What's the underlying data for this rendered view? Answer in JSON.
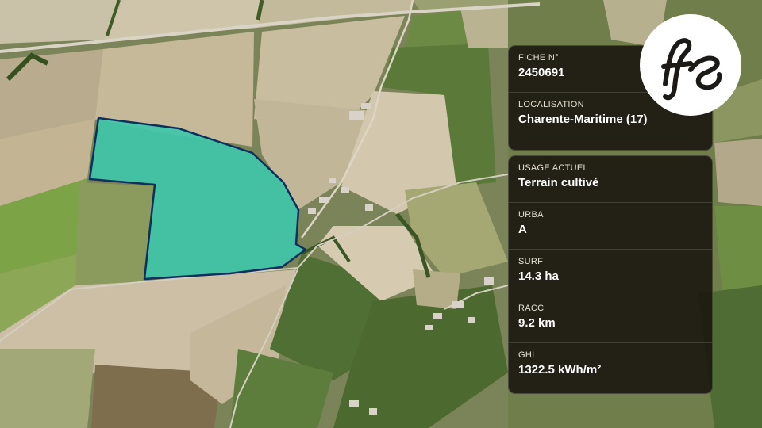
{
  "colors": {
    "parcel_fill": "#3fc6a8",
    "parcel_outline": "#0d2f5e",
    "panel_bg": "rgba(22,18,14,0.86)",
    "logo_bg": "#ffffff",
    "logo_ink": "#1c1a17"
  },
  "logo": {
    "icon": "fs-monogram-logo"
  },
  "fiche": {
    "numero_label": "FICHE N°",
    "numero_value": "2450691",
    "localisation_label": "LOCALISATION",
    "localisation_value": "Charente-Maritime (17)"
  },
  "details": [
    {
      "label": "USAGE ACTUEL",
      "value": "Terrain cultivé"
    },
    {
      "label": "URBA",
      "value": "A"
    },
    {
      "label": "SURF",
      "value": "14.3 ha"
    },
    {
      "label": "RACC",
      "value": "9.2 km"
    },
    {
      "label": "GHI",
      "value": "1322.5 kWh/m²"
    }
  ]
}
